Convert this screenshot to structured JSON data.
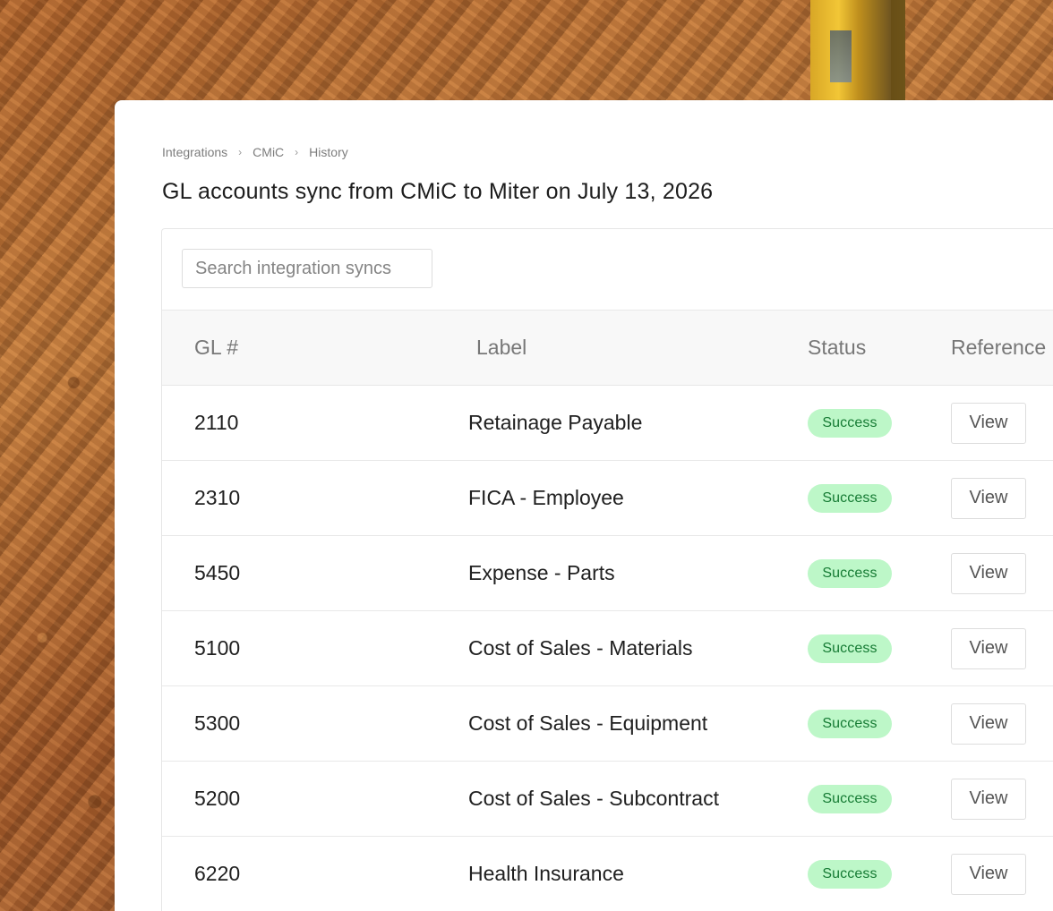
{
  "background": {
    "scene": "construction dirt and machinery"
  },
  "breadcrumb": {
    "items": [
      {
        "label": "Integrations"
      },
      {
        "label": "CMiC"
      },
      {
        "label": "History"
      }
    ],
    "separator_icon": "chevron-right-icon"
  },
  "page": {
    "title": "GL accounts sync from CMiC to Miter on July 13, 2026"
  },
  "search": {
    "placeholder": "Search integration syncs",
    "value": ""
  },
  "table": {
    "headers": [
      "GL #",
      "Label",
      "Status",
      "Reference"
    ],
    "rows": [
      {
        "gl": "2110",
        "label": "Retainage Payable",
        "status": "Success",
        "reference": "View"
      },
      {
        "gl": "2310",
        "label": "FICA - Employee",
        "status": "Success",
        "reference": "View"
      },
      {
        "gl": "5450",
        "label": "Expense - Parts",
        "status": "Success",
        "reference": "View"
      },
      {
        "gl": "5100",
        "label": "Cost of Sales - Materials",
        "status": "Success",
        "reference": "View"
      },
      {
        "gl": "5300",
        "label": "Cost of Sales - Equipment",
        "status": "Success",
        "reference": "View"
      },
      {
        "gl": "5200",
        "label": "Cost of Sales - Subcontract",
        "status": "Success",
        "reference": "View"
      },
      {
        "gl": "6220",
        "label": "Health Insurance",
        "status": "Success",
        "reference": "View"
      }
    ]
  },
  "colors": {
    "success_badge_bg": "#bdf7c8",
    "success_badge_text": "#167b34",
    "panel_bg": "#ffffff",
    "header_bg": "#f8f8f8"
  }
}
